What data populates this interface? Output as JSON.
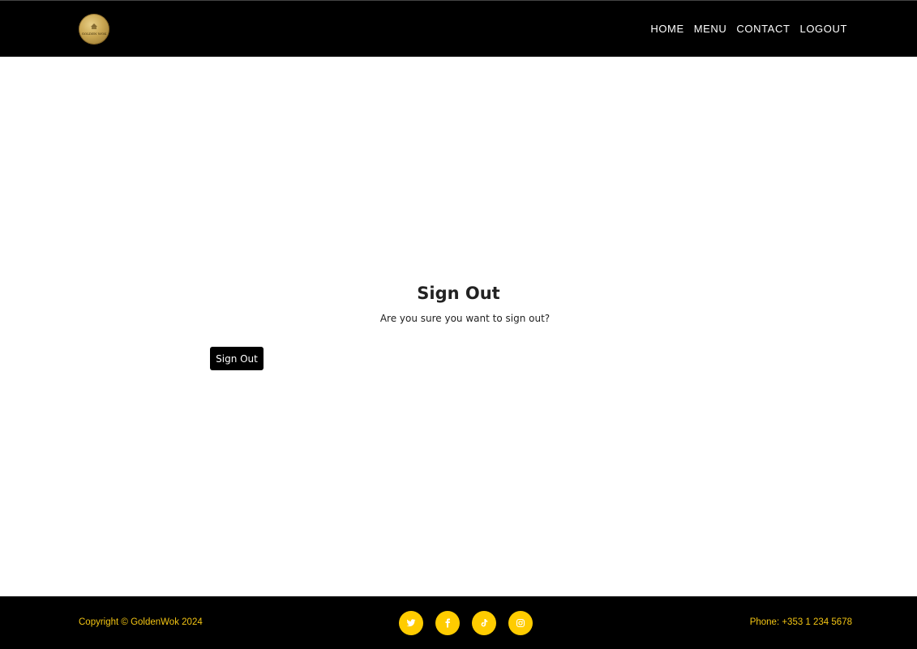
{
  "header": {
    "logo_text": "GOLDEN WOK",
    "nav": [
      {
        "label": "HOME"
      },
      {
        "label": "MENU"
      },
      {
        "label": "CONTACT"
      },
      {
        "label": "LOGOUT"
      }
    ]
  },
  "main": {
    "title": "Sign Out",
    "subtitle": "Are you sure you want to sign out?",
    "button_label": "Sign Out"
  },
  "footer": {
    "copyright": "Copyright © GoldenWok 2024",
    "phone": "Phone: +353 1 234 5678",
    "social": [
      {
        "icon": "twitter-icon"
      },
      {
        "icon": "facebook-icon"
      },
      {
        "icon": "tiktok-icon"
      },
      {
        "icon": "instagram-icon"
      }
    ]
  },
  "colors": {
    "header_bg": "#000000",
    "footer_bg": "#000000",
    "accent": "#ffcc00",
    "footer_text": "#f2c413"
  }
}
